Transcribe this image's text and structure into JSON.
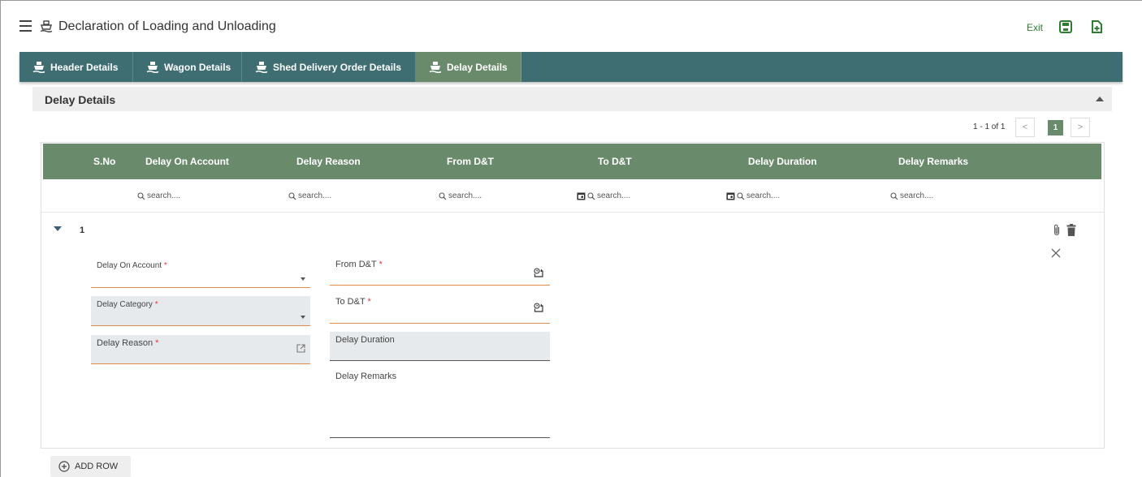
{
  "app": {
    "title": "Declaration of Loading and Unloading",
    "exit_label": "Exit"
  },
  "tabs": [
    {
      "label": "Header Details",
      "active": false
    },
    {
      "label": "Wagon Details",
      "active": false
    },
    {
      "label": "Shed Delivery Order Details",
      "active": false
    },
    {
      "label": "Delay Details",
      "active": true
    }
  ],
  "section": {
    "title": "Delay Details"
  },
  "pagination": {
    "range_text": "1 - 1 of 1",
    "prev": "<",
    "current": "1",
    "next": ">"
  },
  "grid": {
    "columns": [
      "S.No",
      "Delay On Account",
      "Delay Reason",
      "From D&T",
      "To D&T",
      "Delay Duration",
      "Delay Remarks"
    ],
    "filter_placeholder": "search...."
  },
  "row": {
    "number": "1",
    "fields": {
      "delay_on_account": {
        "label": "Delay On Account",
        "required": "*",
        "value": ""
      },
      "delay_category": {
        "label": "Delay Category",
        "required": "*",
        "value": ""
      },
      "delay_reason": {
        "label": "Delay Reason",
        "required": "*",
        "value": ""
      },
      "from_dt": {
        "label": "From D&T",
        "required": "*",
        "value": ""
      },
      "to_dt": {
        "label": "To D&T",
        "required": "*",
        "value": ""
      },
      "delay_duration": {
        "label": "Delay Duration",
        "value": ""
      },
      "delay_remarks": {
        "label": "Delay Remarks",
        "value": ""
      }
    }
  },
  "add_row_label": "ADD ROW",
  "colors": {
    "tab_bar": "#3e6e72",
    "accent_green": "#6a8a6c",
    "underline": "#e08a45",
    "required": "#e53935"
  }
}
